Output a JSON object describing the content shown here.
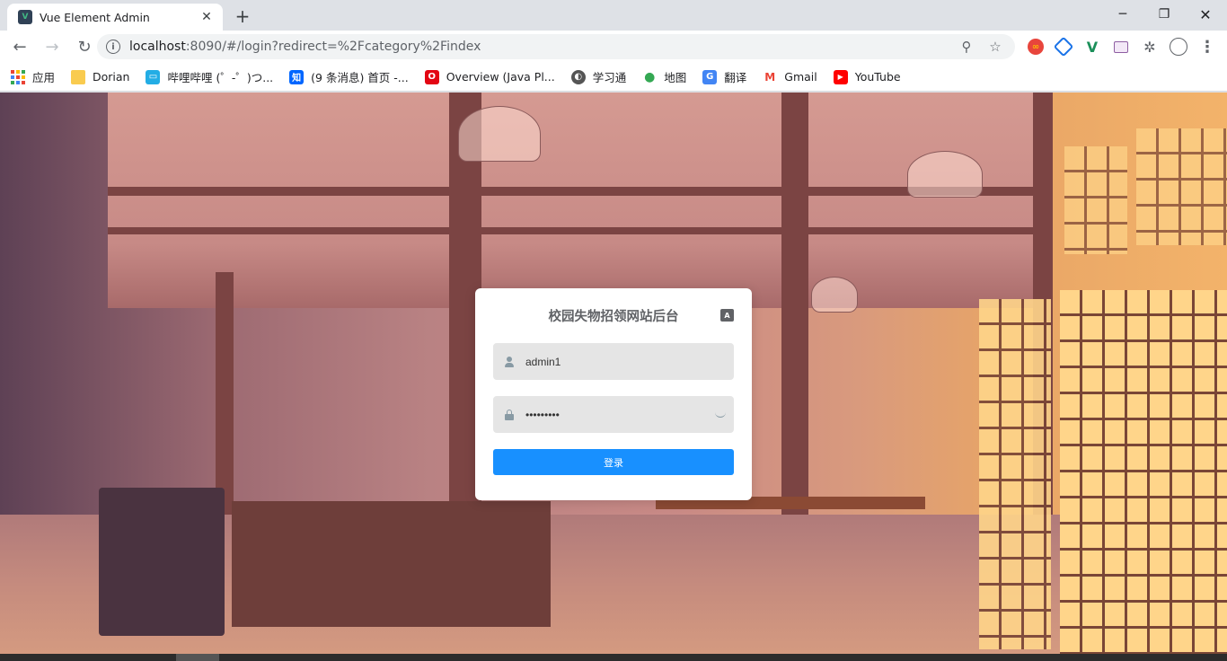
{
  "browser": {
    "tab": {
      "title": "Vue Element Admin",
      "favicon_text": "V",
      "close": "✕"
    },
    "new_tab": "+",
    "window_controls": {
      "minimize": "─",
      "maximize": "❐",
      "close": "✕"
    },
    "nav": {
      "back": "←",
      "forward": "→",
      "reload": "↻"
    },
    "omnibox": {
      "info": "i",
      "url_host": "localhost",
      "url_rest": ":8090/#/login?redirect=%2Fcategory%2Findex",
      "zoom_icon": "⚲",
      "star_icon": "☆"
    },
    "extensions": {
      "ext_circle_text": "∞",
      "ext_v_text": "V",
      "puzzle": "✲",
      "menu": "⋮"
    }
  },
  "bookmarks": [
    {
      "label": "应用",
      "icon": "apps-grid-icon",
      "color": "#ffffff"
    },
    {
      "label": "Dorian",
      "icon": "folder-icon",
      "color": "#f9cb4f"
    },
    {
      "label": "哔哩哔哩 (゜-゜)つ...",
      "icon": "bilibili-icon",
      "color": "#23ade5"
    },
    {
      "label": "(9 条消息) 首页 -...",
      "icon": "zhihu-icon",
      "color": "#0066ff"
    },
    {
      "label": "Overview (Java Pl...",
      "icon": "oracle-icon",
      "color": "#e30613"
    },
    {
      "label": "学习通",
      "icon": "xuexitong-icon",
      "color": "#555555"
    },
    {
      "label": "地图",
      "icon": "maps-icon",
      "color": "#34a853"
    },
    {
      "label": "翻译",
      "icon": "translate-icon",
      "color": "#4285f4"
    },
    {
      "label": "Gmail",
      "icon": "gmail-icon",
      "color": "#ea4335"
    },
    {
      "label": "YouTube",
      "icon": "youtube-icon",
      "color": "#ff0000"
    }
  ],
  "bookmark_glyphs": {
    "bilibili": "▭",
    "zhihu": "知",
    "oracle": "O",
    "xuexitong": "◐",
    "maps": "●",
    "translate": "G",
    "gmail": "M",
    "youtube": "▶"
  },
  "login": {
    "title": "校园失物招领网站后台",
    "lang_icon_text": "A",
    "username": "admin1",
    "password": "•••••••••",
    "submit_label": "登录"
  },
  "colors": {
    "primary_button": "#1890ff",
    "input_background": "#e5e5e5",
    "title_text": "#606266"
  }
}
